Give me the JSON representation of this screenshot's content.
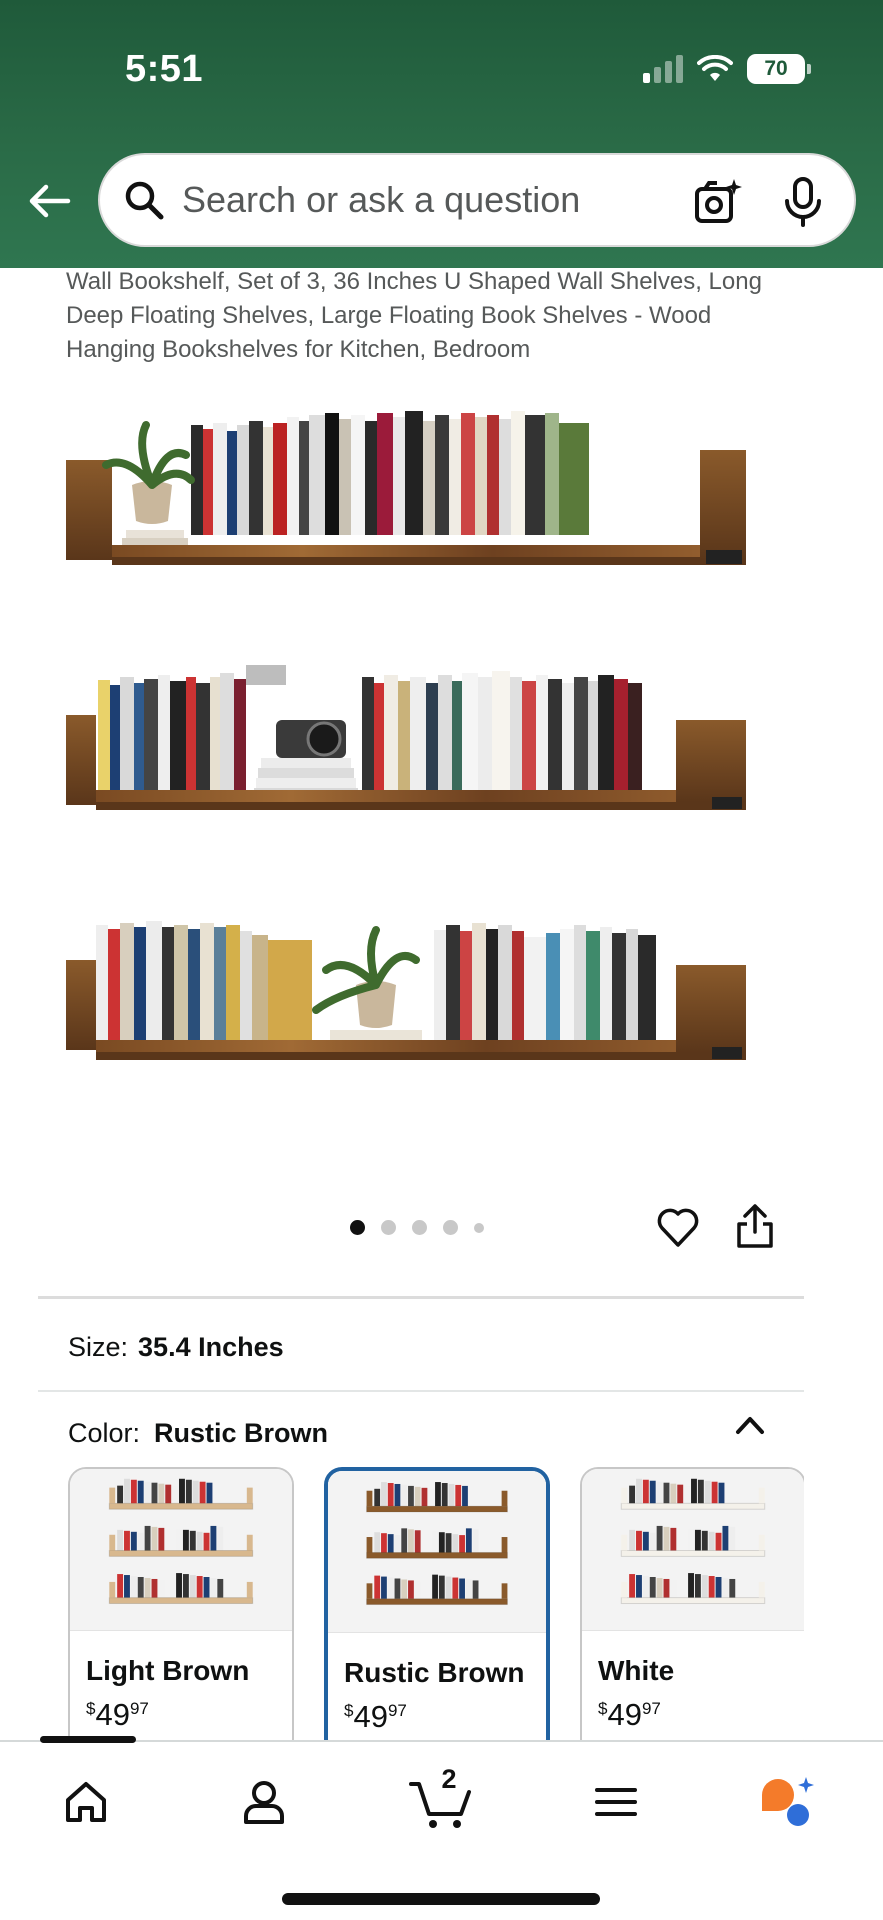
{
  "status_bar": {
    "time": "5:51",
    "battery": "70"
  },
  "search": {
    "placeholder": "Search or ask a question"
  },
  "product": {
    "title": "Wall Bookshelf, Set of 3, 36 Inches U Shaped Wall Shelves, Long Deep Floating Shelves, Large Floating Book Shelves - Wood Hanging Bookshelves for Kitchen, Bedroom",
    "image_count": 5,
    "active_image": 1
  },
  "size": {
    "label": "Size:",
    "value": "35.4 Inches"
  },
  "color": {
    "label": "Color:",
    "value": "Rustic Brown",
    "options": [
      {
        "name": "Light Brown",
        "currency": "$",
        "whole": "49",
        "fraction": "97",
        "shelf_color": "#d8b88e",
        "selected": false
      },
      {
        "name": "Rustic Brown",
        "currency": "$",
        "whole": "49",
        "fraction": "97",
        "shelf_color": "#8a5a2b",
        "selected": true
      },
      {
        "name": "White",
        "currency": "$",
        "whole": "49",
        "fraction": "97",
        "shelf_color": "#f4f1ea",
        "selected": false
      }
    ]
  },
  "bottom_nav": {
    "cart_count": "2"
  },
  "colors": {
    "header_green": "#2a6b47",
    "selected_border": "#2162a1",
    "wood": "#8a5a2b"
  }
}
